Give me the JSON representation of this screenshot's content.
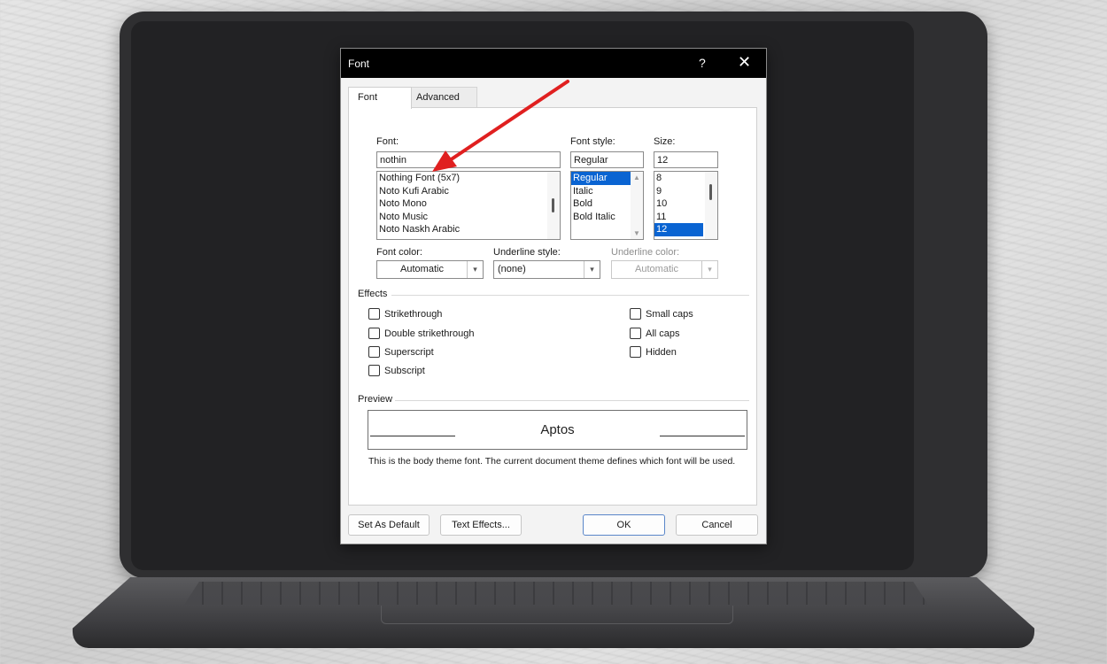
{
  "dialog": {
    "title": "Font",
    "help": "?",
    "close": "✕"
  },
  "tabs": [
    {
      "label": "Font",
      "active": true
    },
    {
      "label": "Advanced",
      "active": false
    }
  ],
  "font": {
    "label": "Font:",
    "value": "nothin",
    "list": [
      "Nothing Font (5x7)",
      "Noto Kufi Arabic",
      "Noto Mono",
      "Noto Music",
      "Noto Naskh Arabic"
    ]
  },
  "style": {
    "label": "Font style:",
    "value": "Regular",
    "list": [
      "Regular",
      "Italic",
      "Bold",
      "Bold Italic"
    ],
    "selected": "Regular"
  },
  "size": {
    "label": "Size:",
    "value": "12",
    "list": [
      "8",
      "9",
      "10",
      "11",
      "12"
    ],
    "selected": "12"
  },
  "color": {
    "label": "Font color:",
    "value": "Automatic"
  },
  "underline_style": {
    "label": "Underline style:",
    "value": "(none)"
  },
  "underline_color": {
    "label": "Underline color:",
    "value": "Automatic"
  },
  "effects": {
    "label": "Effects",
    "left": [
      "Strikethrough",
      "Double strikethrough",
      "Superscript",
      "Subscript"
    ],
    "right": [
      "Small caps",
      "All caps",
      "Hidden"
    ]
  },
  "preview": {
    "label": "Preview",
    "sample": "Aptos",
    "note": "This is the body theme font. The current document theme defines which font will be used."
  },
  "buttons": {
    "set_default": "Set As Default",
    "text_effects": "Text Effects...",
    "ok": "OK",
    "cancel": "Cancel"
  },
  "colors": {
    "selection": "#0a64d2",
    "annotation_arrow": "#e02020",
    "titlebar": "#000000"
  }
}
